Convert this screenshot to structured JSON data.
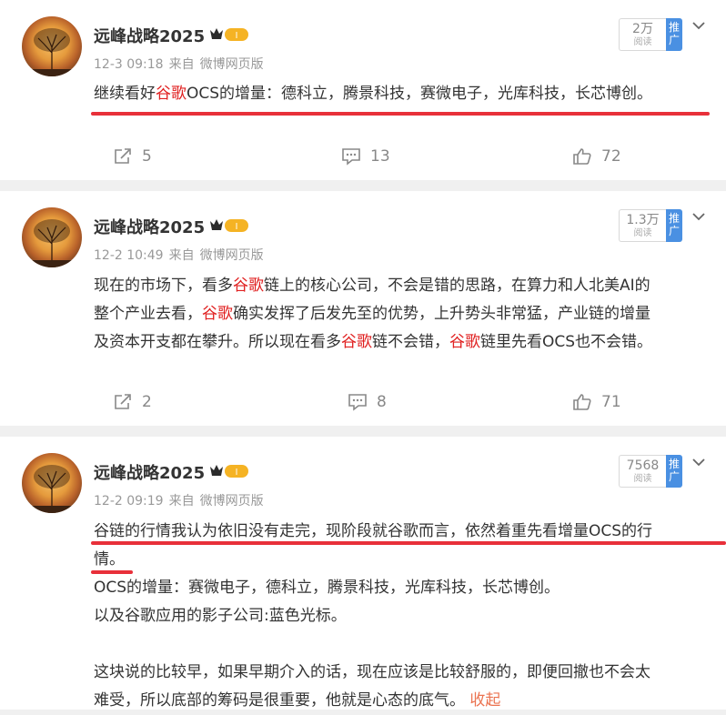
{
  "colors": {
    "highlight": "#e02020",
    "underline": "#e8303a",
    "promote": "#4a90e2",
    "collapse": "#eb7350"
  },
  "posts": [
    {
      "author": "远峰战略2025",
      "vip_level": "I",
      "date": "12-3 09:18",
      "source_prefix": "来自",
      "source": "微博网页版",
      "views": "2万",
      "views_label": "阅读",
      "promote": "推广",
      "text_parts": [
        "继续看好",
        "谷歌",
        "OCS的增量：德科立，腾景科技，赛微电子，光库科技，长芯博创。"
      ],
      "reposts": "5",
      "comments": "13",
      "likes": "72"
    },
    {
      "author": "远峰战略2025",
      "vip_level": "I",
      "date": "12-2 10:49",
      "source_prefix": "来自",
      "source": "微博网页版",
      "views": "1.3万",
      "views_label": "阅读",
      "promote": "推广",
      "line1": [
        "现在的市场下，看多",
        "谷歌",
        "链上的核心公司，不会是错的思路，在算力和人北美AI的"
      ],
      "line2": [
        "整个产业去看，",
        "谷歌",
        "确实发挥了后发先至的优势，上升势头非常猛，产业链的增量"
      ],
      "line3": [
        "及资本开支都在攀升。所以现在看多",
        "谷歌",
        "链不会错，",
        "谷歌",
        "链里先看OCS也不会错。"
      ],
      "reposts": "2",
      "comments": "8",
      "likes": "71"
    },
    {
      "author": "远峰战略2025",
      "vip_level": "I",
      "date": "12-2 09:19",
      "source_prefix": "来自",
      "source": "微博网页版",
      "views": "7568",
      "views_label": "阅读",
      "promote": "推广",
      "line1": "谷链的行情我认为依旧没有走完，现阶段就谷歌而言，依然着重先看增量OCS的行",
      "line2": "情。",
      "line3": "OCS的增量：赛微电子，德科立，腾景科技，光库科技，长芯博创。",
      "line4": "以及谷歌应用的影子公司:蓝色光标。",
      "line5": "这块说的比较早，如果早期介入的话，现在应该是比较舒服的，即便回撤也不会太",
      "line6": "难受，所以底部的筹码是很重要，他就是心态的底气。",
      "collapse": "收起"
    }
  ]
}
